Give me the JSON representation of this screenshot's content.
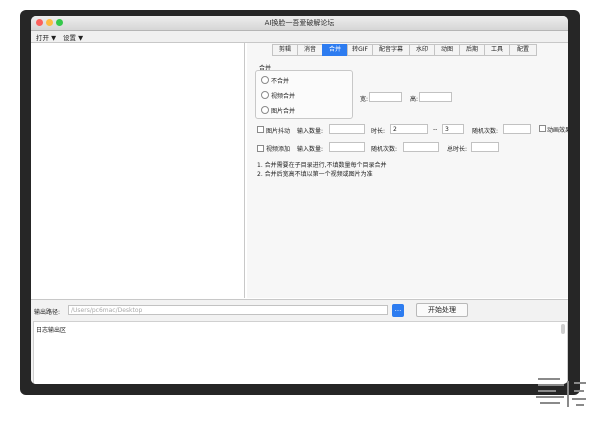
{
  "window": {
    "title": "AI换脸一吾爱破解论坛"
  },
  "colors": {
    "accent": "#2d7cf0",
    "close": "#fc605c",
    "minimize": "#fdbc40",
    "zoom": "#34c84a"
  },
  "menu": [
    {
      "label": "打开",
      "icon": "triangle-down-icon"
    },
    {
      "label": "设置",
      "icon": "triangle-down-icon"
    }
  ],
  "tabs": [
    "剪辑",
    "消音",
    "合并",
    "转GIF",
    "配音字幕",
    "水印",
    "动图",
    "后期",
    "工具",
    "配置"
  ],
  "active_tab": "合并",
  "merge": {
    "group_label": "合并",
    "options": [
      "不合并",
      "视频合并",
      "图片合并"
    ],
    "width_label": "宽:",
    "height_label": "高:",
    "image_shake": {
      "label": "图片抖动",
      "count_label": "输入数量:",
      "duration_label": "时长:",
      "dur_from": "2",
      "range_sep": "--",
      "dur_to": "3",
      "random_label": "随机次数:",
      "anim_label": "动画效果"
    },
    "video_random": {
      "label": "视频添加",
      "count_label": "输入数量:",
      "random_label": "随机次数:",
      "total_label": "总时长:"
    },
    "notes": [
      "1. 合并需要在子目录进行,不填数量每个目录合并",
      "2. 合并后宽高不填以第一个视频或图片为准"
    ]
  },
  "output": {
    "label": "输出路径:",
    "path_placeholder": "/Users/pc6mac/Desktop",
    "browse_label": "...",
    "start_label": "开始处理"
  },
  "log": {
    "text": "日志输出区"
  }
}
